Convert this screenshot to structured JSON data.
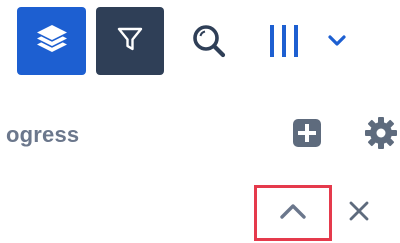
{
  "toolbar": {
    "layers_icon": "layers-icon",
    "filter_icon": "filter-icon",
    "search_icon": "search-icon",
    "columns_icon": "columns-icon",
    "columns_menu_icon": "chevron-down-icon"
  },
  "column": {
    "title": "ogress",
    "add_icon": "plus-square-icon",
    "settings_icon": "gear-icon"
  },
  "row": {
    "collapse_icon": "chevron-up-icon",
    "close_icon": "close-icon"
  },
  "colors": {
    "primary": "#1d5fd1",
    "dark": "#2f3f57",
    "highlight": "#e53a4c",
    "muted": "#6b778c"
  }
}
